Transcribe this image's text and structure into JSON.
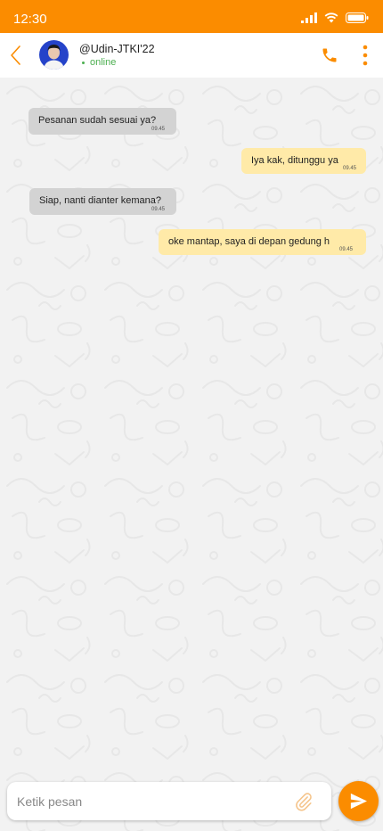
{
  "status_bar": {
    "time": "12:30"
  },
  "header": {
    "contact_name": "@Udin-JTKI'22",
    "status": "online"
  },
  "messages": [
    {
      "direction": "incoming",
      "text": "Pesanan sudah sesuai ya?",
      "time": "09.45"
    },
    {
      "direction": "outgoing",
      "text": "Iya kak, ditunggu ya",
      "time": "09.45"
    },
    {
      "direction": "incoming",
      "text": "Siap, nanti dianter kemana?",
      "time": "09.45"
    },
    {
      "direction": "outgoing",
      "text": "oke mantap, saya di depan gedung h",
      "time": "09.45"
    }
  ],
  "composer": {
    "placeholder": "Ketik pesan"
  },
  "colors": {
    "accent": "#fb8c00",
    "incoming_bubble": "#d3d3d3",
    "outgoing_bubble": "#ffeaa8",
    "online": "#4caf50"
  },
  "icons": [
    "signal-icon",
    "wifi-icon",
    "battery-icon",
    "back-icon",
    "phone-icon",
    "more-vertical-icon",
    "paperclip-icon",
    "send-icon"
  ]
}
